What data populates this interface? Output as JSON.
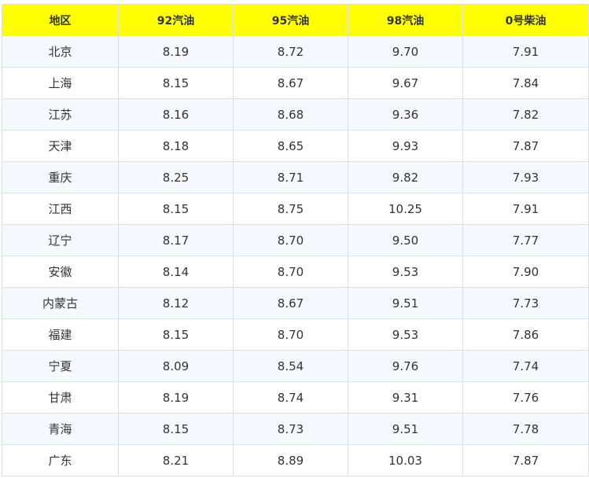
{
  "table": {
    "header_color": "#ffff00",
    "headers": [
      "地区",
      "92汽油",
      "95汽油",
      "98汽油",
      "0号柴油"
    ],
    "rows": [
      [
        "北京",
        "8.19",
        "8.72",
        "9.70",
        "7.91"
      ],
      [
        "上海",
        "8.15",
        "8.67",
        "9.67",
        "7.84"
      ],
      [
        "江苏",
        "8.16",
        "8.68",
        "9.36",
        "7.82"
      ],
      [
        "天津",
        "8.18",
        "8.65",
        "9.93",
        "7.87"
      ],
      [
        "重庆",
        "8.25",
        "8.71",
        "9.82",
        "7.93"
      ],
      [
        "江西",
        "8.15",
        "8.75",
        "10.25",
        "7.91"
      ],
      [
        "辽宁",
        "8.17",
        "8.70",
        "9.50",
        "7.77"
      ],
      [
        "安徽",
        "8.14",
        "8.70",
        "9.53",
        "7.90"
      ],
      [
        "内蒙古",
        "8.12",
        "8.67",
        "9.51",
        "7.73"
      ],
      [
        "福建",
        "8.15",
        "8.70",
        "9.53",
        "7.86"
      ],
      [
        "宁夏",
        "8.09",
        "8.54",
        "9.76",
        "7.74"
      ],
      [
        "甘肃",
        "8.19",
        "8.74",
        "9.31",
        "7.76"
      ],
      [
        "青海",
        "8.15",
        "8.73",
        "9.51",
        "7.78"
      ],
      [
        "广东",
        "8.21",
        "8.89",
        "10.03",
        "7.87"
      ]
    ]
  }
}
